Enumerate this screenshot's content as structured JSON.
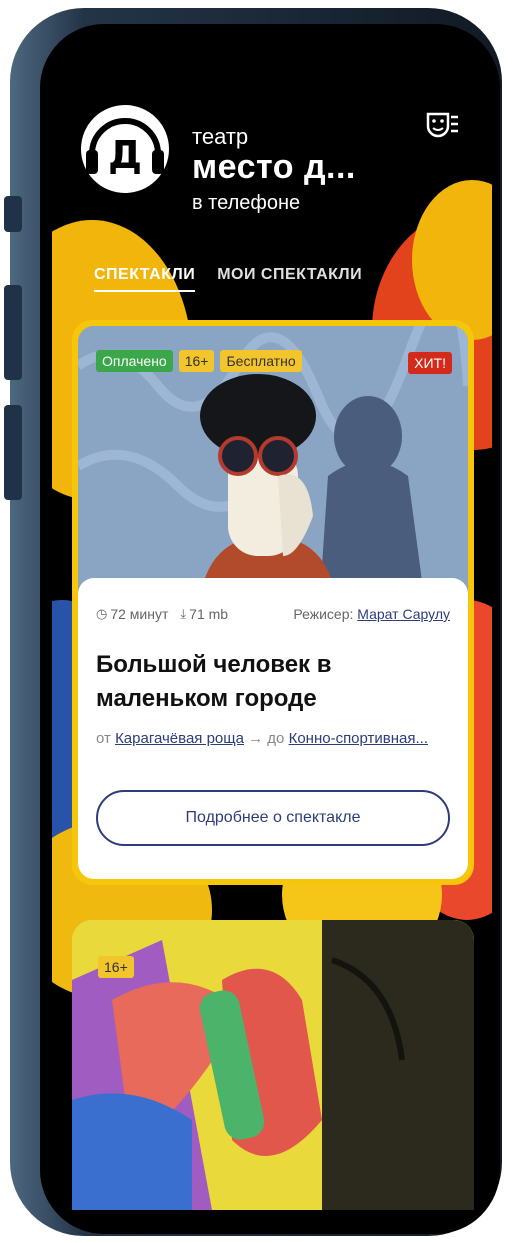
{
  "header": {
    "logo_letter": "Д",
    "title_small": "театр",
    "title_big": "место д...",
    "title_sub": "в телефоне"
  },
  "tabs": [
    {
      "label": "СПЕКТАКЛИ",
      "active": true
    },
    {
      "label": "МОИ СПЕКТАКЛИ",
      "active": false
    }
  ],
  "card1": {
    "badges": [
      "Оплачено",
      "16+",
      "Бесплатно"
    ],
    "hit": "ХИТ!",
    "duration": "72 минут",
    "size": "71 mb",
    "director_label": "Режисер:",
    "director_name": "Марат Сарулу",
    "title": "Большой человек в маленьком городе",
    "from_label": "от",
    "from_place": "Карагачёвая роща",
    "to_label": "до",
    "to_place": "Конно-спортивная...",
    "more_button": "Подробнее о спектакле"
  },
  "card2": {
    "age": "16+"
  },
  "colors": {
    "accent": "#2d3c7a",
    "yellow": "#f6c60b",
    "red": "#d42a1b",
    "green": "#3aa84a"
  }
}
